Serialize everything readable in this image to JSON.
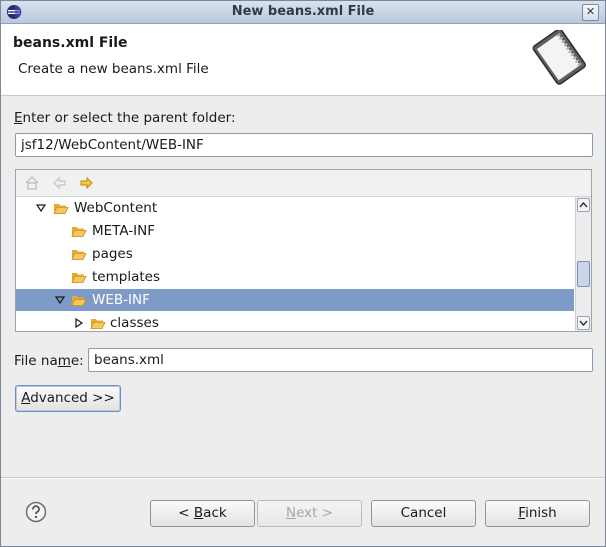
{
  "window": {
    "title": "New beans.xml File",
    "close_label": "✕"
  },
  "header": {
    "title": "beans.xml File",
    "description": "Create a new beans.xml File"
  },
  "folder": {
    "label_first": "E",
    "label_rest": "nter or select the parent folder:",
    "path_value": "jsf12/WebContent/WEB-INF"
  },
  "tree": {
    "toolbar": {
      "home": "home-icon",
      "back": "back-arrow-icon",
      "forward": "forward-arrow-icon"
    },
    "items": [
      {
        "label": "WebContent",
        "expanded": true,
        "has_children": true,
        "level": 1,
        "selected": false
      },
      {
        "label": "META-INF",
        "expanded": false,
        "has_children": false,
        "level": 2,
        "selected": false
      },
      {
        "label": "pages",
        "expanded": false,
        "has_children": false,
        "level": 2,
        "selected": false
      },
      {
        "label": "templates",
        "expanded": false,
        "has_children": false,
        "level": 2,
        "selected": false
      },
      {
        "label": "WEB-INF",
        "expanded": true,
        "has_children": true,
        "level": 2,
        "selected": true
      },
      {
        "label": "classes",
        "expanded": false,
        "has_children": true,
        "level": 3,
        "selected": false
      }
    ]
  },
  "file": {
    "label_pre": "File na",
    "label_mnemonic": "m",
    "label_post": "e:",
    "value": "beans.xml"
  },
  "advanced": {
    "mnemonic": "A",
    "rest": "dvanced >>"
  },
  "buttons": {
    "back_pre": "< ",
    "back_mnemonic": "B",
    "back_post": "ack",
    "next_mnemonic": "N",
    "next_post": "ext >",
    "cancel": "Cancel",
    "finish_mnemonic": "F",
    "finish_post": "inish"
  },
  "colors": {
    "selection": "#7e9ac6",
    "folder": "#f0b443"
  }
}
